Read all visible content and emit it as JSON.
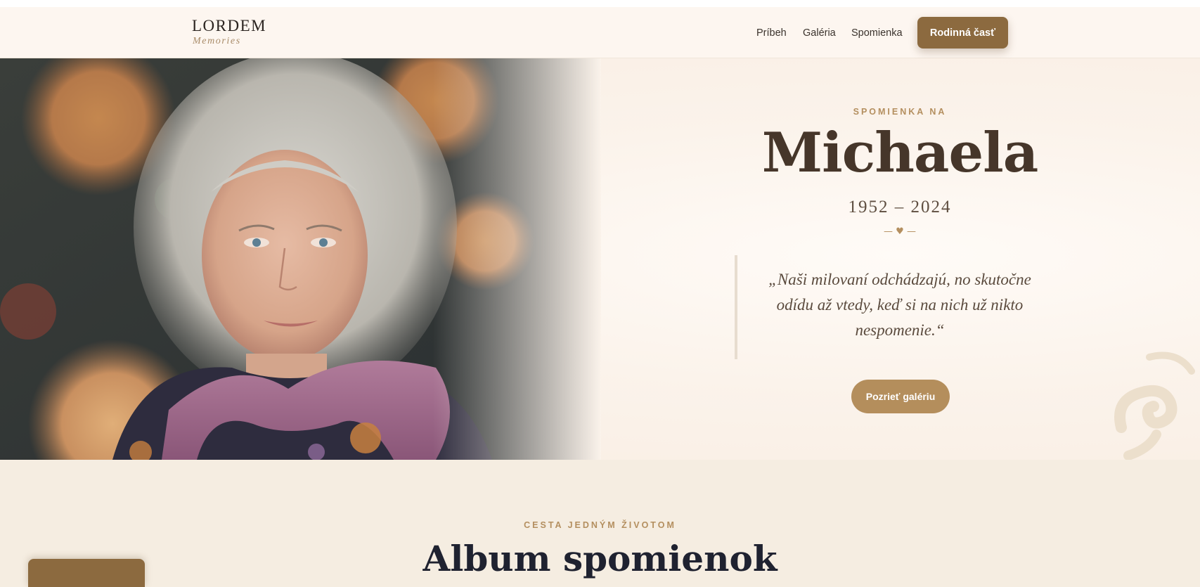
{
  "brand": {
    "name": "LORDEM",
    "tagline": "Memories"
  },
  "nav": {
    "links": [
      "Príbeh",
      "Galéria",
      "Spomienka"
    ],
    "cta": "Rodinná časť"
  },
  "hero": {
    "eyebrow": "SPOMIENKA NA",
    "name": "Michaela",
    "years": "1952 – 2024",
    "divider": "— ♥ —",
    "quote": "„Naši milovaní odchádzajú, no skutočne odídu až vtedy, keď si na nich už nikto nespomenie.“",
    "button": "Pozrieť galériu"
  },
  "album": {
    "eyebrow": "CESTA JEDNÝM ŽIVOTOM",
    "title": "Album spomienok"
  },
  "colors": {
    "accent": "#8c6a3f",
    "gold": "#b48e5c",
    "cream": "#f5ede1"
  }
}
